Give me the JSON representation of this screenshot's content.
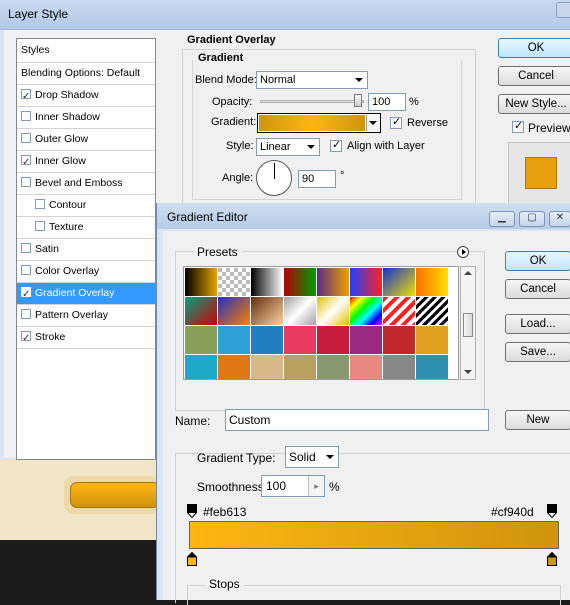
{
  "layer_style": {
    "window_title": "Layer Style",
    "list_header": "Styles",
    "items": [
      {
        "label": "Blending Options: Default",
        "has_checkbox": false,
        "checked": false,
        "indent": false,
        "selected": false
      },
      {
        "label": "Drop Shadow",
        "has_checkbox": true,
        "checked": true,
        "indent": false,
        "selected": false
      },
      {
        "label": "Inner Shadow",
        "has_checkbox": true,
        "checked": false,
        "indent": false,
        "selected": false
      },
      {
        "label": "Outer Glow",
        "has_checkbox": true,
        "checked": false,
        "indent": false,
        "selected": false
      },
      {
        "label": "Inner Glow",
        "has_checkbox": true,
        "checked": true,
        "indent": false,
        "selected": false
      },
      {
        "label": "Bevel and Emboss",
        "has_checkbox": true,
        "checked": false,
        "indent": false,
        "selected": false
      },
      {
        "label": "Contour",
        "has_checkbox": true,
        "checked": false,
        "indent": true,
        "selected": false
      },
      {
        "label": "Texture",
        "has_checkbox": true,
        "checked": false,
        "indent": true,
        "selected": false
      },
      {
        "label": "Satin",
        "has_checkbox": true,
        "checked": false,
        "indent": false,
        "selected": false
      },
      {
        "label": "Color Overlay",
        "has_checkbox": true,
        "checked": false,
        "indent": false,
        "selected": false
      },
      {
        "label": "Gradient Overlay",
        "has_checkbox": true,
        "checked": true,
        "indent": false,
        "selected": true
      },
      {
        "label": "Pattern Overlay",
        "has_checkbox": true,
        "checked": false,
        "indent": false,
        "selected": false
      },
      {
        "label": "Stroke",
        "has_checkbox": true,
        "checked": true,
        "indent": false,
        "selected": false
      }
    ],
    "panel": {
      "section_title": "Gradient Overlay",
      "group_title": "Gradient",
      "blend_mode_label": "Blend Mode:",
      "blend_mode_value": "Normal",
      "opacity_label": "Opacity:",
      "opacity_value": "100",
      "opacity_unit": "%",
      "gradient_label": "Gradient:",
      "reverse_label": "Reverse",
      "reverse_checked": true,
      "style_label": "Style:",
      "style_value": "Linear",
      "align_label": "Align with Layer",
      "align_checked": true,
      "angle_label": "Angle:",
      "angle_value": "90",
      "angle_unit": "°"
    },
    "buttons": {
      "ok": "OK",
      "cancel": "Cancel",
      "new_style": "New Style...",
      "preview": "Preview",
      "preview_checked": true
    }
  },
  "gradient_editor": {
    "window_title": "Gradient Editor",
    "presets_label": "Presets",
    "name_label": "Name:",
    "name_value": "Custom",
    "new_button": "New",
    "ok_button": "OK",
    "cancel_button": "Cancel",
    "load_button": "Load...",
    "save_button": "Save...",
    "gradient_type_label": "Gradient Type:",
    "gradient_type_value": "Solid",
    "smoothness_label": "Smoothness:",
    "smoothness_value": "100",
    "smoothness_unit": "%",
    "stops_label": "Stops",
    "left_color_label": "#feb613",
    "right_color_label": "#cf940d"
  },
  "colors": {
    "gradient_start": "#feb613",
    "gradient_end": "#cf940d",
    "selection": "#3399ff"
  },
  "presets": [
    "linear-gradient(90deg,#000,#e8a300)",
    "repeating-conic-gradient(#fff 0 25%,#bbb 0 50%) 0 0/8px 8px",
    "linear-gradient(90deg,#000,#fff)",
    "linear-gradient(90deg,#b00000,#00a000)",
    "linear-gradient(90deg,#5a2d82,#f0a000)",
    "linear-gradient(90deg,#2040ff,#ff2020)",
    "linear-gradient(135deg,#1030d0,#f0e000)",
    "linear-gradient(90deg,#ff7000,#ffe000)",
    "linear-gradient(135deg,#00a080,#d00000)",
    "linear-gradient(135deg,#2030c0,#ff8000)",
    "linear-gradient(135deg,#603010,#ffd0a0)",
    "linear-gradient(135deg,#a0a0a0,#fff,#a0a0a0)",
    "linear-gradient(135deg,#e0c000,#fff,#e0c000)",
    "linear-gradient(135deg,#ff0000,#ffff00,#00ff00,#00ffff,#0000ff,#ff00ff)",
    "repeating-linear-gradient(135deg,#ff2020 0 4px,#fff 4px 8px)",
    "repeating-linear-gradient(135deg,#000 0 3px,#fff 3px 6px)",
    "linear-gradient(#8aa05a,#8aa05a)",
    "linear-gradient(#2f9fd8,#2f9fd8)",
    "linear-gradient(#1f7fc0,#1f7fc0)",
    "linear-gradient(#e83a60,#e83a60)",
    "linear-gradient(#c81c3c,#c81c3c)",
    "linear-gradient(#9a2a80,#9a2a80)",
    "linear-gradient(#c0282c,#c0282c)",
    "linear-gradient(#e0a020,#e0a020)",
    "linear-gradient(#20a8c8,#20a8c8)",
    "linear-gradient(#e07818,#e07818)",
    "linear-gradient(#d8b888,#d8b888)",
    "linear-gradient(#b8a060,#b8a060)",
    "linear-gradient(#889870,#889870)",
    "linear-gradient(#e88880,#e88880)",
    "linear-gradient(#888888,#888888)",
    "linear-gradient(#3090b0,#3090b0)"
  ]
}
